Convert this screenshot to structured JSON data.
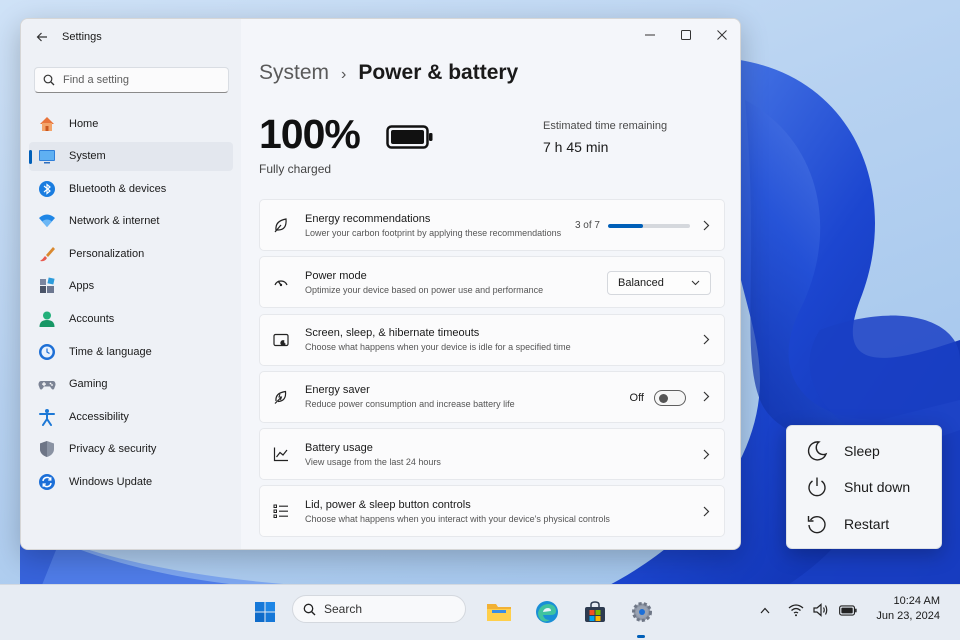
{
  "window": {
    "app_title": "Settings"
  },
  "search": {
    "placeholder": "Find a setting"
  },
  "sidebar": {
    "items": [
      {
        "label": "Home",
        "icon": "home-icon",
        "active": false
      },
      {
        "label": "System",
        "icon": "system-monitor-icon",
        "active": true
      },
      {
        "label": "Bluetooth & devices",
        "icon": "bluetooth-icon",
        "active": false
      },
      {
        "label": "Network & internet",
        "icon": "wifi-icon",
        "active": false
      },
      {
        "label": "Personalization",
        "icon": "brush-icon",
        "active": false
      },
      {
        "label": "Apps",
        "icon": "apps-icon",
        "active": false
      },
      {
        "label": "Accounts",
        "icon": "person-icon",
        "active": false
      },
      {
        "label": "Time & language",
        "icon": "globe-clock-icon",
        "active": false
      },
      {
        "label": "Gaming",
        "icon": "gamepad-icon",
        "active": false
      },
      {
        "label": "Accessibility",
        "icon": "accessibility-icon",
        "active": false
      },
      {
        "label": "Privacy & security",
        "icon": "shield-icon",
        "active": false
      },
      {
        "label": "Windows Update",
        "icon": "update-icon",
        "active": false
      }
    ]
  },
  "breadcrumb": {
    "parent": "System",
    "separator": "›",
    "current": "Power & battery"
  },
  "battery": {
    "percent_text": "100%",
    "level": 1.0,
    "status": "Fully charged",
    "estimate_label": "Estimated time remaining",
    "estimate_value": "7 h 45 min"
  },
  "cards": {
    "energy_recommendations": {
      "title": "Energy recommendations",
      "subtitle": "Lower your carbon footprint by applying these recommendations",
      "progress_text": "3 of 7",
      "progress_fraction": 0.4286
    },
    "power_mode": {
      "title": "Power mode",
      "subtitle": "Optimize your device based on power use and performance",
      "selected": "Balanced"
    },
    "screen_sleep": {
      "title": "Screen, sleep, & hibernate timeouts",
      "subtitle": "Choose what happens when your device is idle for a specified time"
    },
    "energy_saver": {
      "title": "Energy saver",
      "subtitle": "Reduce power consumption and increase battery life",
      "state_label": "Off",
      "enabled": false
    },
    "battery_usage": {
      "title": "Battery usage",
      "subtitle": "View usage from the last 24 hours"
    },
    "lid_power": {
      "title": "Lid, power & sleep button controls",
      "subtitle": "Choose what happens when you interact with your device's physical controls"
    }
  },
  "power_menu": {
    "items": [
      {
        "label": "Sleep",
        "icon": "moon-icon"
      },
      {
        "label": "Shut down",
        "icon": "power-icon"
      },
      {
        "label": "Restart",
        "icon": "restart-icon"
      }
    ]
  },
  "taskbar": {
    "search_label": "Search",
    "clock_time": "10:24 AM",
    "clock_date": "Jun 23, 2024"
  },
  "colors": {
    "accent": "#005fb8",
    "wallpaper_blue": "#1f4fd1"
  }
}
